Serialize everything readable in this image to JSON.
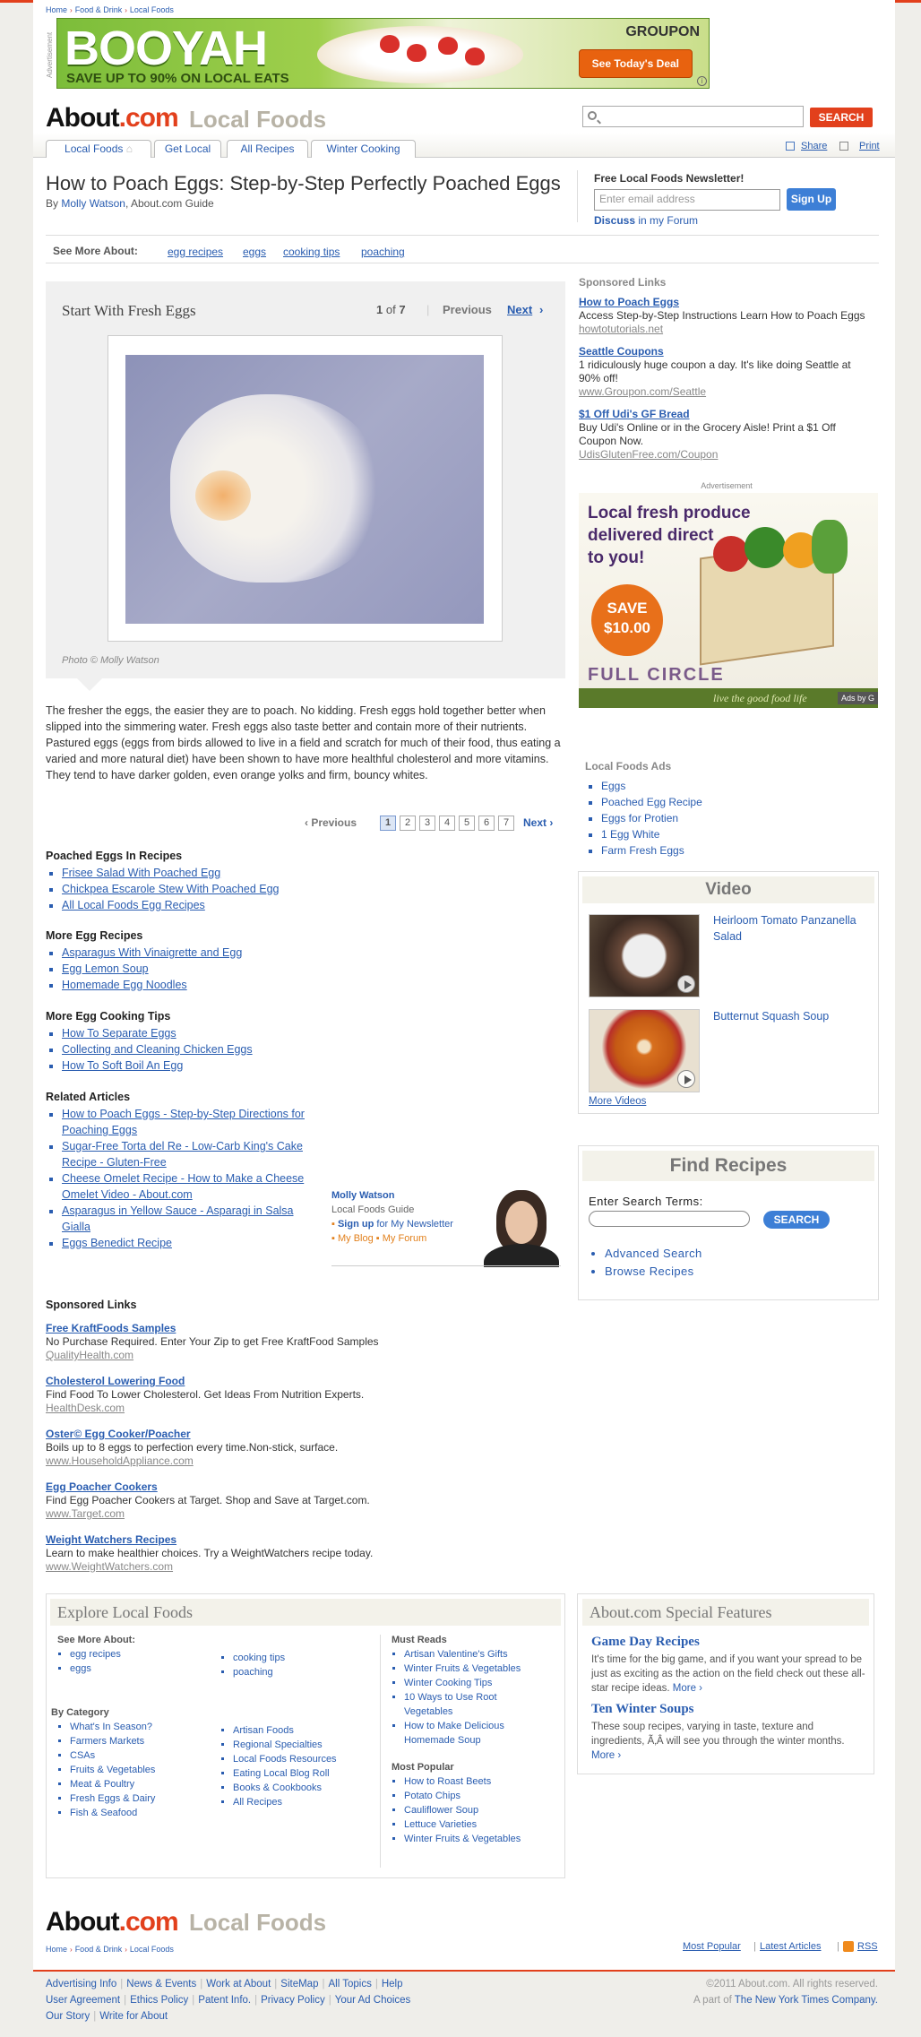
{
  "breadcrumb": [
    "Home",
    "Food & Drink",
    "Local Foods"
  ],
  "ad": {
    "label": "Advertisement",
    "headline": "BOOYAH",
    "sub": "SAVE UP TO 90% ON LOCAL EATS",
    "brand": "GROUPON",
    "cta": "See Today's Deal"
  },
  "header": {
    "logo_a": "About",
    "logo_b": ".com",
    "section": "Local Foods",
    "search_button": "SEARCH"
  },
  "nav": {
    "tabs": [
      "Local Foods",
      "Get Local",
      "All Recipes",
      "Winter Cooking"
    ],
    "share": "Share",
    "print": "Print"
  },
  "article": {
    "title": "How to Poach Eggs: Step-by-Step Perfectly Poached Eggs",
    "by": "By",
    "author": "Molly Watson",
    "guide": ", About.com Guide"
  },
  "newsletter": {
    "title": "Free Local Foods Newsletter!",
    "placeholder": "Enter email address",
    "button": "Sign Up",
    "discuss": "Discuss",
    "forum": " in my Forum"
  },
  "see_more": {
    "label": "See More About:",
    "links": [
      "egg recipes",
      "eggs",
      "cooking tips",
      "poaching"
    ]
  },
  "slide": {
    "title": "Start With Fresh Eggs",
    "current": "1",
    "of": " of ",
    "total": "7",
    "previous": "Previous",
    "next": "Next",
    "credit": "Photo © Molly Watson"
  },
  "body_text": "The fresher the eggs, the easier they are to poach. No kidding. Fresh eggs hold together better when slipped into the simmering water. Fresh eggs also taste better and contain more of their nutrients. Pastured eggs (eggs from birds allowed to live in a field and scratch for much of their food, thus eating a varied and more natural diet) have been shown to have more healthful cholesterol and more vitamins. They tend to have darker golden, even orange yolks and firm, bouncy whites.",
  "pagination": {
    "previous": "‹ Previous",
    "pages": [
      "1",
      "2",
      "3",
      "4",
      "5",
      "6",
      "7"
    ],
    "next": "Next ›"
  },
  "link_groups": [
    {
      "title": "Poached Eggs In Recipes",
      "links": [
        "Frisee Salad With Poached Egg",
        "Chickpea Escarole Stew With Poached Egg",
        "All Local Foods Egg Recipes"
      ]
    },
    {
      "title": "More Egg Recipes",
      "links": [
        "Asparagus With Vinaigrette and Egg",
        "Egg Lemon Soup",
        "Homemade Egg Noodles"
      ]
    },
    {
      "title": "More Egg Cooking Tips",
      "links": [
        "How To Separate Eggs",
        "Collecting and Cleaning Chicken Eggs",
        "How To Soft Boil An Egg"
      ]
    },
    {
      "title": "Related Articles",
      "links": [
        "How to Poach Eggs - Step-by-Step Directions for Poaching Eggs",
        "Sugar-Free Torta del Re - Low-Carb King's Cake Recipe - Gluten-Free",
        "Cheese Omelet Recipe - How to Make a Cheese Omelet Video - About.com",
        "Asparagus in Yellow Sauce - Asparagi in Salsa Gialla",
        "Eggs Benedict Recipe"
      ]
    }
  ],
  "author_box": {
    "name": "Molly Watson",
    "role": "Local Foods Guide",
    "signup": "Sign up",
    "newsletter": " for My Newsletter",
    "blog": "My Blog",
    "forum": "My Forum"
  },
  "sponsored_bottom": {
    "title": "Sponsored Links",
    "items": [
      {
        "t": "Free KraftFoods Samples",
        "d": "No Purchase Required. Enter Your Zip to get Free KraftFood Samples",
        "u": "QualityHealth.com"
      },
      {
        "t": "Cholesterol Lowering Food",
        "d": "Find Food To Lower Cholesterol. Get Ideas From Nutrition Experts.",
        "u": "HealthDesk.com"
      },
      {
        "t": "Oster© Egg Cooker/Poacher",
        "d": "Boils up to 8 eggs to perfection every time.Non-stick, surface.",
        "u": "www.HouseholdAppliance.com"
      },
      {
        "t": "Egg Poacher Cookers",
        "d": "Find Egg Poacher Cookers at Target. Shop and Save at Target.com.",
        "u": "www.Target.com"
      },
      {
        "t": "Weight Watchers Recipes",
        "d": "Learn to make healthier choices. Try a WeightWatchers recipe today.",
        "u": "www.WeightWatchers.com"
      }
    ]
  },
  "sponsored_right": {
    "title": "Sponsored Links",
    "items": [
      {
        "t": "How to Poach Eggs",
        "d": "Access Step-by-Step Instructions Learn How to Poach Eggs",
        "u": "howtotutorials.net"
      },
      {
        "t": "Seattle Coupons",
        "d": "1 ridiculously huge coupon a day. It's like doing Seattle at 90% off!",
        "u": "www.Groupon.com/Seattle"
      },
      {
        "t": "$1 Off Udi's GF Bread",
        "d": "Buy Udi's Online or in the Grocery Aisle! Print a $1 Off Coupon Now.",
        "u": "UdisGlutenFree.com/Coupon"
      }
    ]
  },
  "side_ad": {
    "label": "Advertisement",
    "line1": "Local fresh produce",
    "line2": "delivered direct",
    "line3": "to you!",
    "save": "SAVE",
    "amount": "$10.00",
    "brand": "FULL CIRCLE",
    "tagline": "live the good food life",
    "adsby": "Ads by G"
  },
  "local_ads": {
    "title": "Local Foods Ads",
    "items": [
      "Eggs",
      "Poached Egg Recipe",
      "Eggs for Protien",
      "1 Egg White",
      "Farm Fresh Eggs"
    ]
  },
  "video": {
    "title": "Video",
    "items": [
      "Heirloom Tomato Panzanella Salad",
      "Butternut Squash Soup"
    ],
    "more": "More Videos"
  },
  "find_recipes": {
    "title": "Find Recipes",
    "label": "Enter Search Terms:",
    "button": "SEARCH",
    "links": [
      "Advanced Search",
      "Browse Recipes"
    ]
  },
  "explore": {
    "title": "Explore Local Foods",
    "see_more_label": "See More About:",
    "see_more_a": [
      "egg recipes",
      "eggs"
    ],
    "see_more_b": [
      "cooking tips",
      "poaching"
    ],
    "by_category_label": "By Category",
    "cat_a": [
      "What's In Season?",
      "Farmers Markets",
      "CSAs",
      "Fruits & Vegetables",
      "Meat & Poultry",
      "Fresh Eggs & Dairy",
      "Fish & Seafood"
    ],
    "cat_b": [
      "Artisan Foods",
      "Regional Specialties",
      "Local Foods Resources",
      "Eating Local Blog Roll",
      "Books & Cookbooks",
      "All Recipes"
    ],
    "must_reads_label": "Must Reads",
    "must_reads": [
      "Artisan Valentine's Gifts",
      "Winter Fruits & Vegetables",
      "Winter Cooking Tips",
      "10 Ways to Use Root Vegetables",
      "How to Make Delicious Homemade Soup"
    ],
    "popular_label": "Most Popular",
    "popular": [
      "How to Roast Beets",
      "Potato Chips",
      "Cauliflower Soup",
      "Lettuce Varieties",
      "Winter Fruits & Vegetables"
    ]
  },
  "special": {
    "title": "About.com Special Features",
    "items": [
      {
        "t": "Game Day Recipes",
        "d": "It's time for the big game, and if you want your spread to be just as exciting as the action on the field check out these all-star recipe ideas.",
        "more": "More ›"
      },
      {
        "t": "Ten Winter Soups",
        "d": "These soup recipes, varying in taste, texture and ingredients, Ã‚Â will see you through the winter months.",
        "more": "More ›"
      }
    ]
  },
  "footer": {
    "links_right": [
      "Most Popular",
      "Latest Articles",
      "RSS"
    ],
    "legal_row1": [
      "Advertising Info",
      "News & Events",
      "Work at About",
      "SiteMap",
      "All Topics",
      "Help"
    ],
    "legal_row2": [
      "User Agreement",
      "Ethics Policy",
      "Patent Info.",
      "Privacy Policy",
      "Your Ad Choices"
    ],
    "legal_row3": [
      "Our Story",
      "Write for About"
    ],
    "copyright": "©2011 About.com. All rights reserved.",
    "part_of": "A part of ",
    "nyt": "The New York Times Company."
  }
}
